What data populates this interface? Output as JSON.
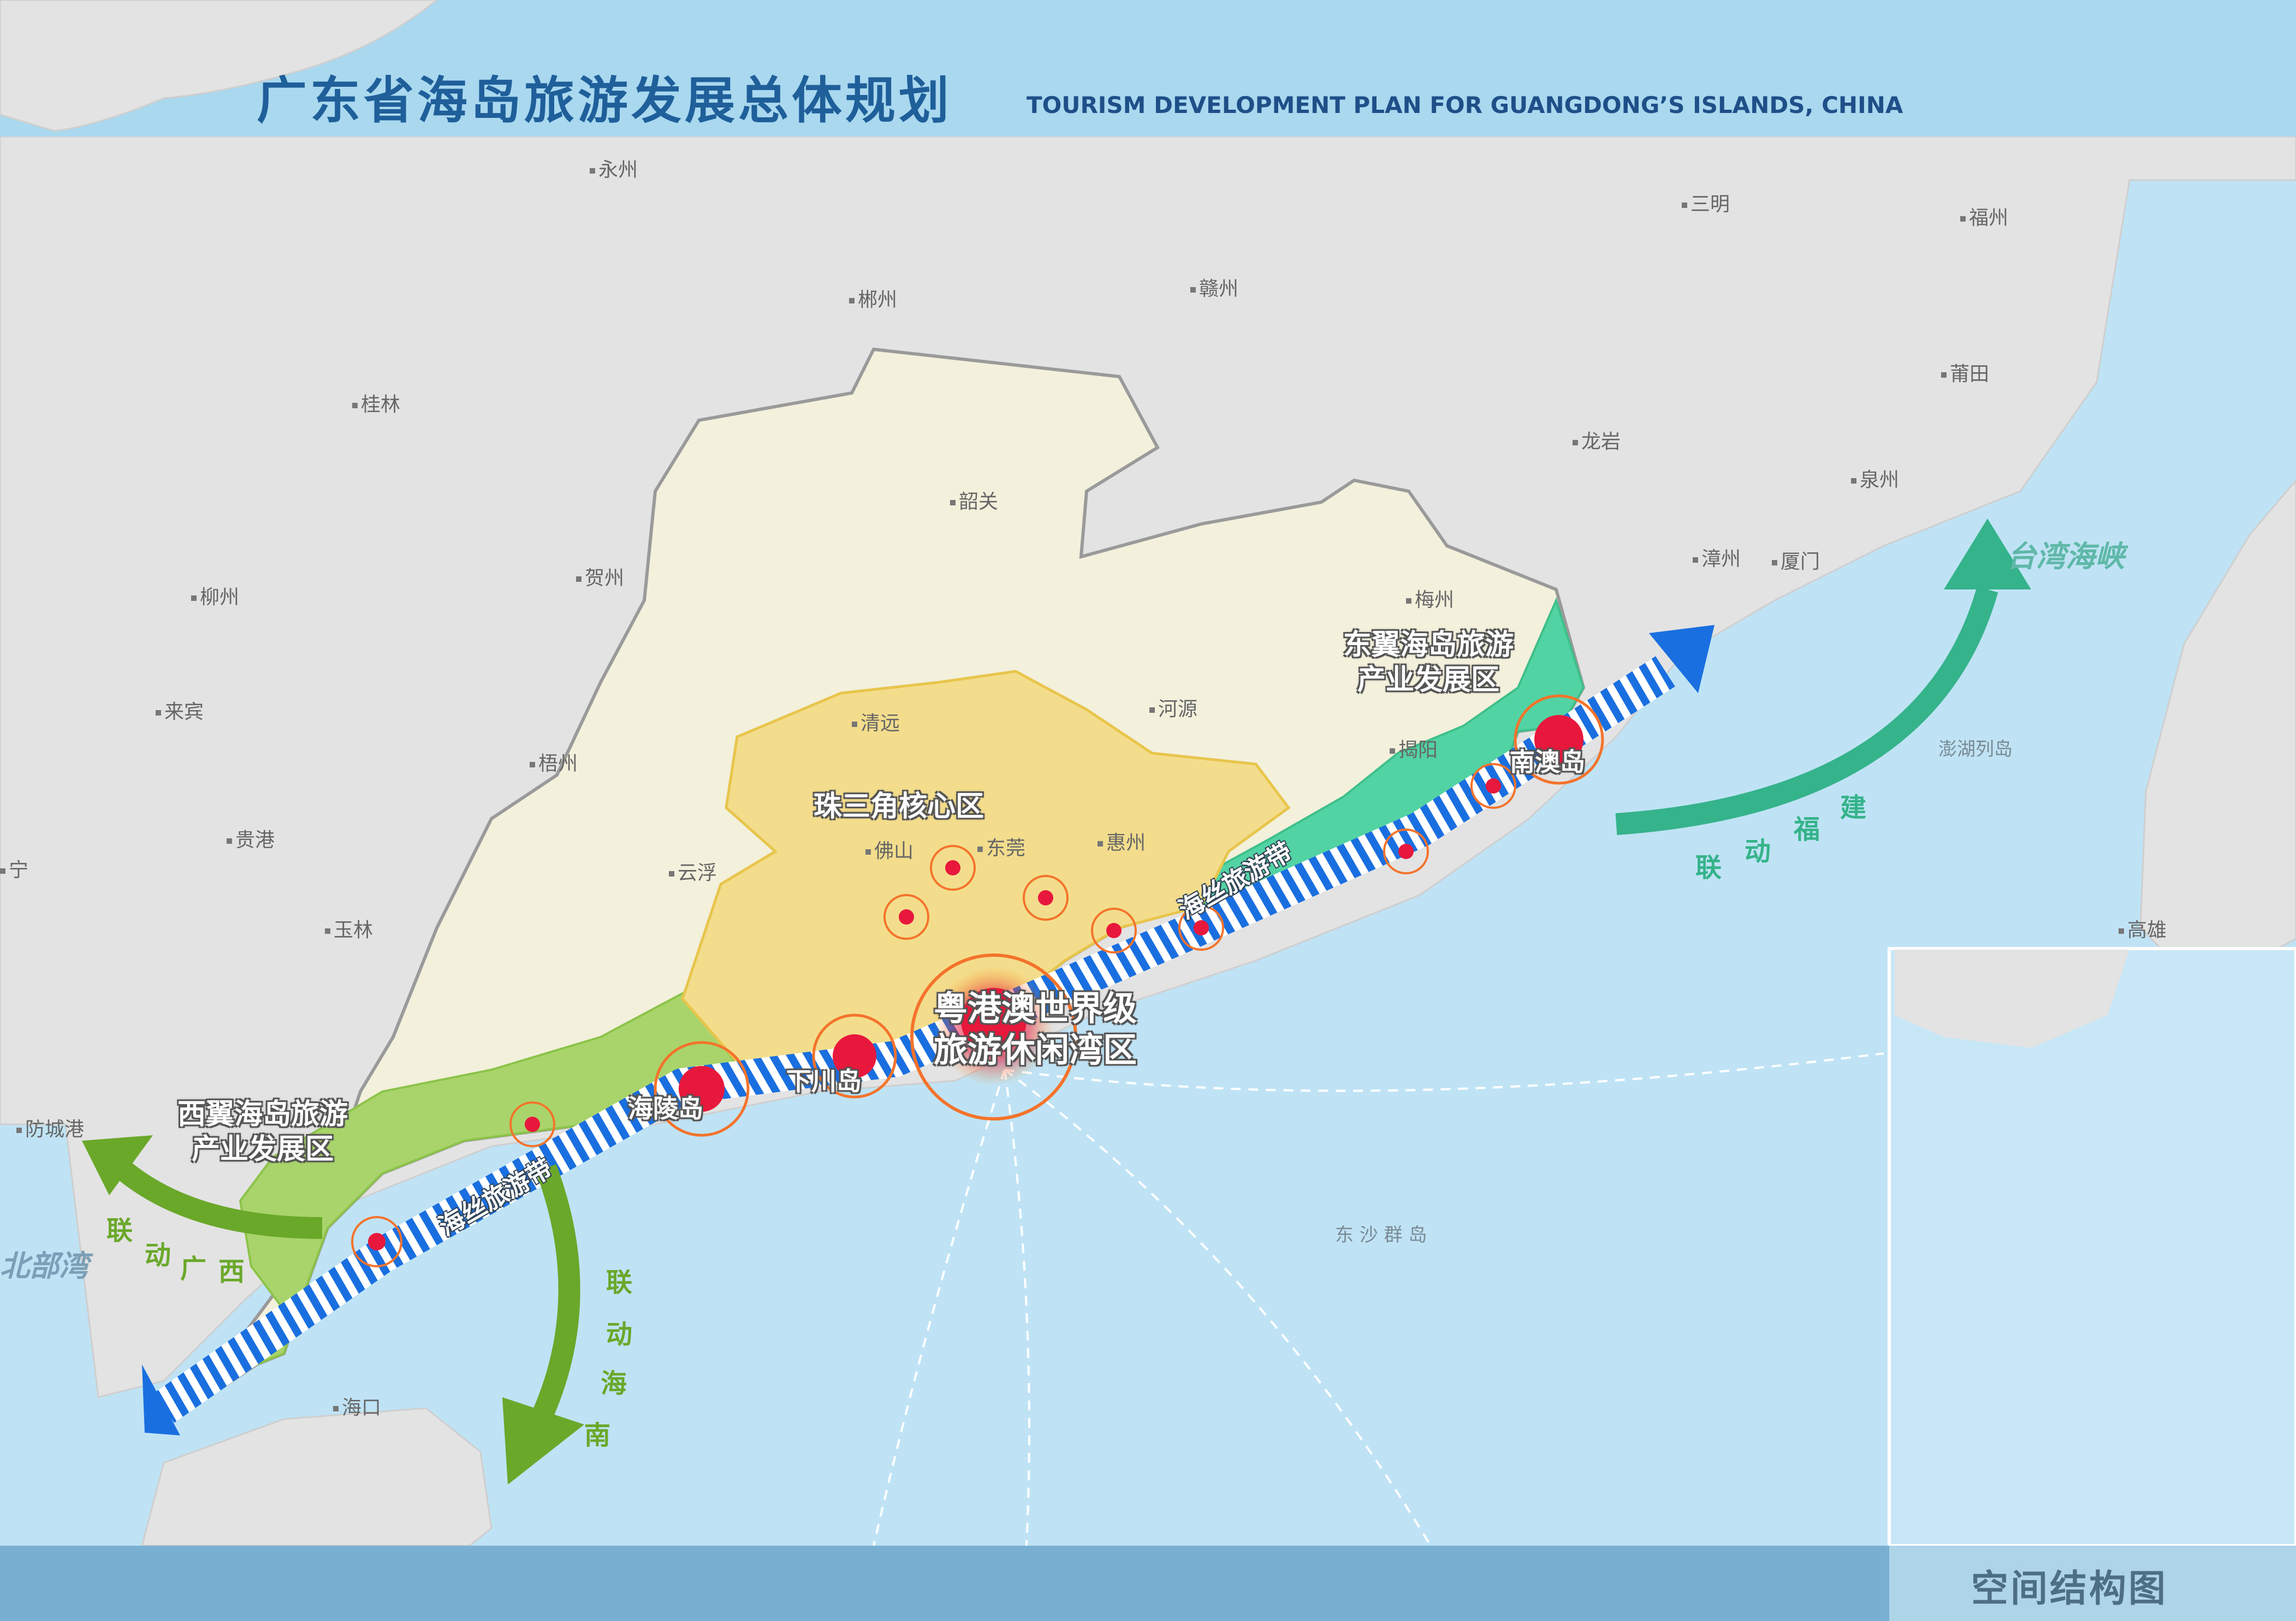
{
  "header": {
    "title_cn": "广东省海岛旅游发展总体规划",
    "title_en": "TOURISM DEVELOPMENT PLAN FOR GUANGDONG’S ISLANDS, CHINA"
  },
  "footer": {
    "caption": "空间结构图"
  },
  "cities": {
    "yongzhou": "永州",
    "sanming": "三明",
    "fuzhou": "福州",
    "chenzhou": "郴州",
    "ganzhou": "赣州",
    "guilin": "桂林",
    "putian": "莆田",
    "longyan": "龙岩",
    "quanzhou": "泉州",
    "shaoguan": "韶关",
    "hezhou": "贺州",
    "liuzhou": "柳州",
    "zhangzhou": "漳州",
    "xiamen": "厦门",
    "meizhou": "梅州",
    "laibin": "来宾",
    "qingyuan": "清远",
    "heyuan": "河源",
    "jieyang": "揭阳",
    "wuzhou": "梧州",
    "foshan": "佛山",
    "dongguan": "东莞",
    "huizhou": "惠州",
    "guigang": "贵港",
    "yunfu": "云浮",
    "nanning": "宁",
    "yulin": "玉林",
    "gaoxiong": "高雄",
    "fangchenggang": "防城港",
    "haikou": "海口",
    "penghu": "澎湖列岛",
    "dongsha": "东 沙 群 岛"
  },
  "seas": {
    "beibu": "北部湾",
    "taiwan_strait": "台湾海峡"
  },
  "regions": {
    "prd_core": "珠三角核心区",
    "east_line1": "东翼海岛旅游",
    "east_line2": "产业发展区",
    "west_line1": "西翼海岛旅游",
    "west_line2": "产业发展区",
    "bay_line1": "粤港澳世界级",
    "bay_line2": "旅游休闲湾区"
  },
  "islands": {
    "nanao": "南澳岛",
    "hailing": "海陵岛",
    "xiachuan": "下川岛"
  },
  "bands": {
    "east": "海丝旅游带",
    "west": "海丝旅游带"
  },
  "links": {
    "guangxi": [
      "联",
      "动",
      "广",
      "西"
    ],
    "hainan": [
      "联",
      "动",
      "海",
      "南"
    ],
    "fujian": [
      "联",
      "动",
      "福",
      "建"
    ]
  },
  "colors": {
    "header_band": "#a9d8ef",
    "sea": "#bfe3f5",
    "land": "#e3e3e3",
    "guangdong": "#f3f0dc",
    "prd": "#f3dd8c",
    "east_wing": "#52d3a3",
    "west_wing": "#a9d46b",
    "hotspot": "#e8183c",
    "band_blue": "#1a6fe0",
    "arrow_green": "#6aa82a",
    "arrow_teal": "#35b38a"
  }
}
